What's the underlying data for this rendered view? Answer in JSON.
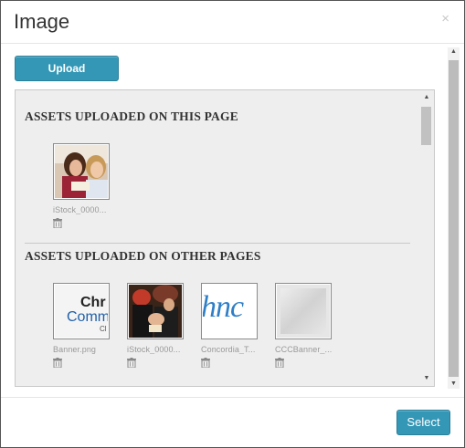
{
  "dialog": {
    "title": "Image",
    "close_label": "×"
  },
  "toolbar": {
    "upload_label": "Upload"
  },
  "assets": {
    "this_page": {
      "heading": "ASSETS UPLOADED ON THIS PAGE",
      "items": [
        {
          "name": "iStock_0000...",
          "icon": "photo-two-women-reading"
        }
      ]
    },
    "other_pages": {
      "heading": "ASSETS UPLOADED ON OTHER PAGES",
      "items": [
        {
          "name": "Banner.png",
          "icon": "banner-text-image",
          "thumb_text_1": "Chr",
          "thumb_text_2": "Comm",
          "thumb_text_3": "Cl"
        },
        {
          "name": "iStock_0000...",
          "icon": "photo-graduation"
        },
        {
          "name": "Concordia_T...",
          "icon": "concordia-logo-image",
          "thumb_text_1": "hnc"
        },
        {
          "name": "CCCBanner_...",
          "icon": "gray-gradient-image"
        }
      ]
    }
  },
  "footer": {
    "select_label": "Select"
  },
  "colors": {
    "accent": "#3497b6",
    "box_background": "#eeeeee",
    "muted_text": "#999999"
  }
}
